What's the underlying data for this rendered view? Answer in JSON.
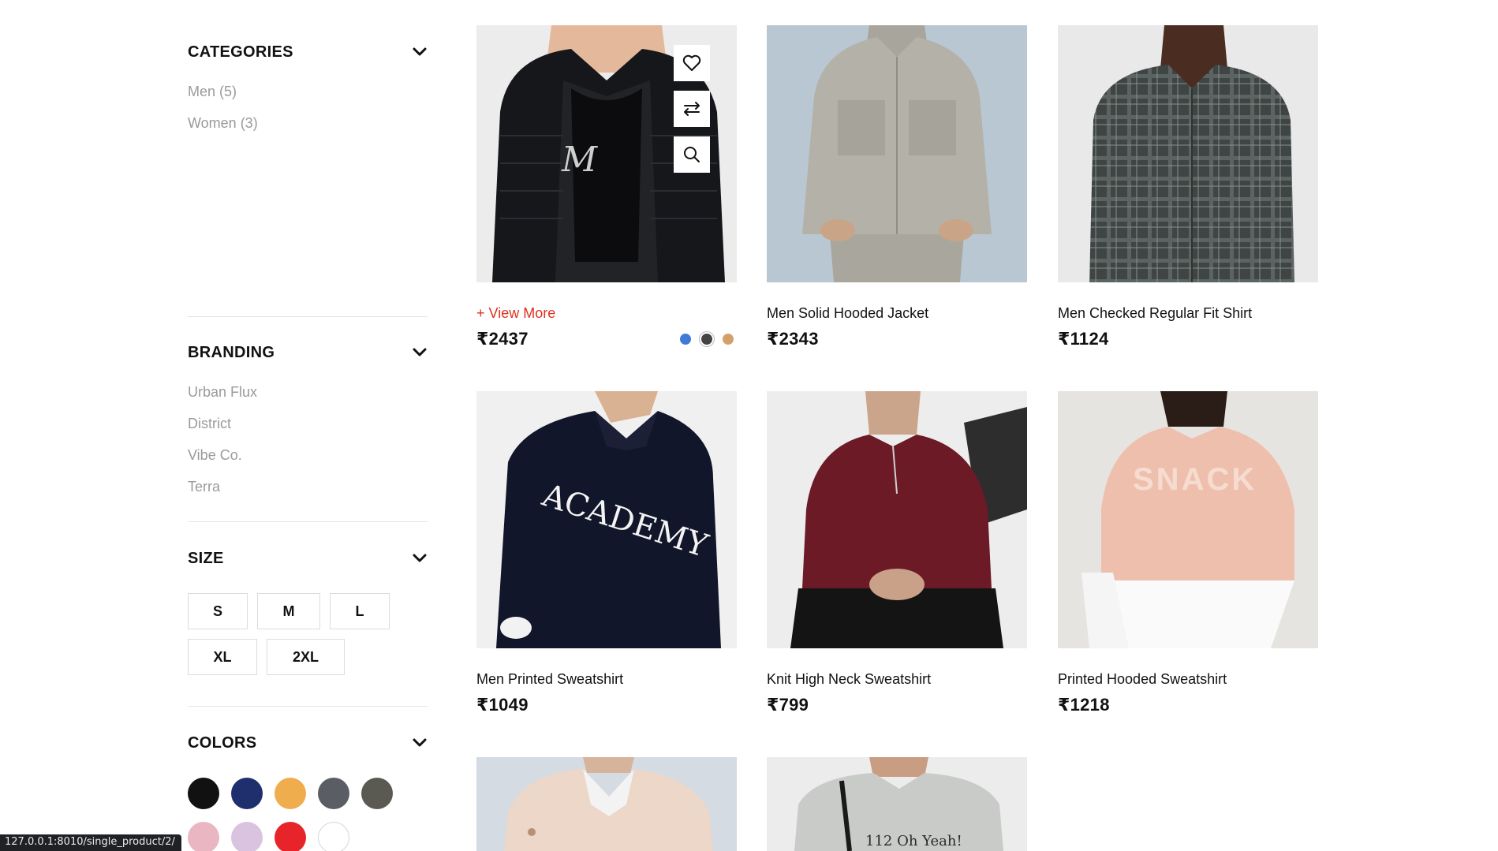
{
  "filters": {
    "categories": {
      "title": "CATEGORIES",
      "items": [
        "Men (5)",
        "Women (3)"
      ]
    },
    "branding": {
      "title": "BRANDING",
      "items": [
        "Urban Flux",
        "District",
        "Vibe Co.",
        "Terra"
      ]
    },
    "size": {
      "title": "SIZE",
      "options": [
        "S",
        "M",
        "L",
        "XL",
        "2XL"
      ]
    },
    "colors": {
      "title": "COLORS",
      "swatches": [
        "#111111",
        "#1f2f6e",
        "#f0ad4e",
        "#5a5d63",
        "#5b5a52",
        "#eab6c2",
        "#d9c3e0",
        "#e8242b",
        "#ffffff"
      ]
    }
  },
  "products": [
    {
      "name": "",
      "view_more": "+ View More",
      "price": "₹2437",
      "icon": "black-puffer-jacket",
      "bg": "#eeeeee",
      "color_options": [
        "#3f7ad8",
        "#444444",
        "#d4a06a"
      ],
      "actions": [
        "heart-icon",
        "compare-icon",
        "search-icon"
      ]
    },
    {
      "name": "Men Solid Hooded Jacket",
      "price": "₹2343",
      "icon": "grey-hooded-jacket",
      "bg": "#b9c7d3"
    },
    {
      "name": "Men Checked Regular Fit Shirt",
      "price": "₹1124",
      "icon": "checked-shirt",
      "bg": "#e9e9e9"
    },
    {
      "name": "Men Printed Sweatshirt",
      "price": "₹1049",
      "icon": "navy-academy-sweatshirt",
      "bg": "#f0f0f0"
    },
    {
      "name": "Knit High Neck Sweatshirt",
      "price": "₹799",
      "icon": "maroon-knit-sweatshirt",
      "bg": "#ededed"
    },
    {
      "name": "Printed Hooded Sweatshirt",
      "price": "₹1218",
      "icon": "pink-hooded-sweatshirt",
      "bg": "#e6e4e1"
    },
    {
      "name": "",
      "price": "",
      "icon": "pink-biker-jacket",
      "bg": "#d4dbe2"
    },
    {
      "name": "",
      "price": "",
      "icon": "grey-graphic-tshirt",
      "bg": "#ececec",
      "print_text": "112 Oh Yeah!"
    }
  ],
  "status_url": "127.0.0.1:8010/single_product/2/"
}
